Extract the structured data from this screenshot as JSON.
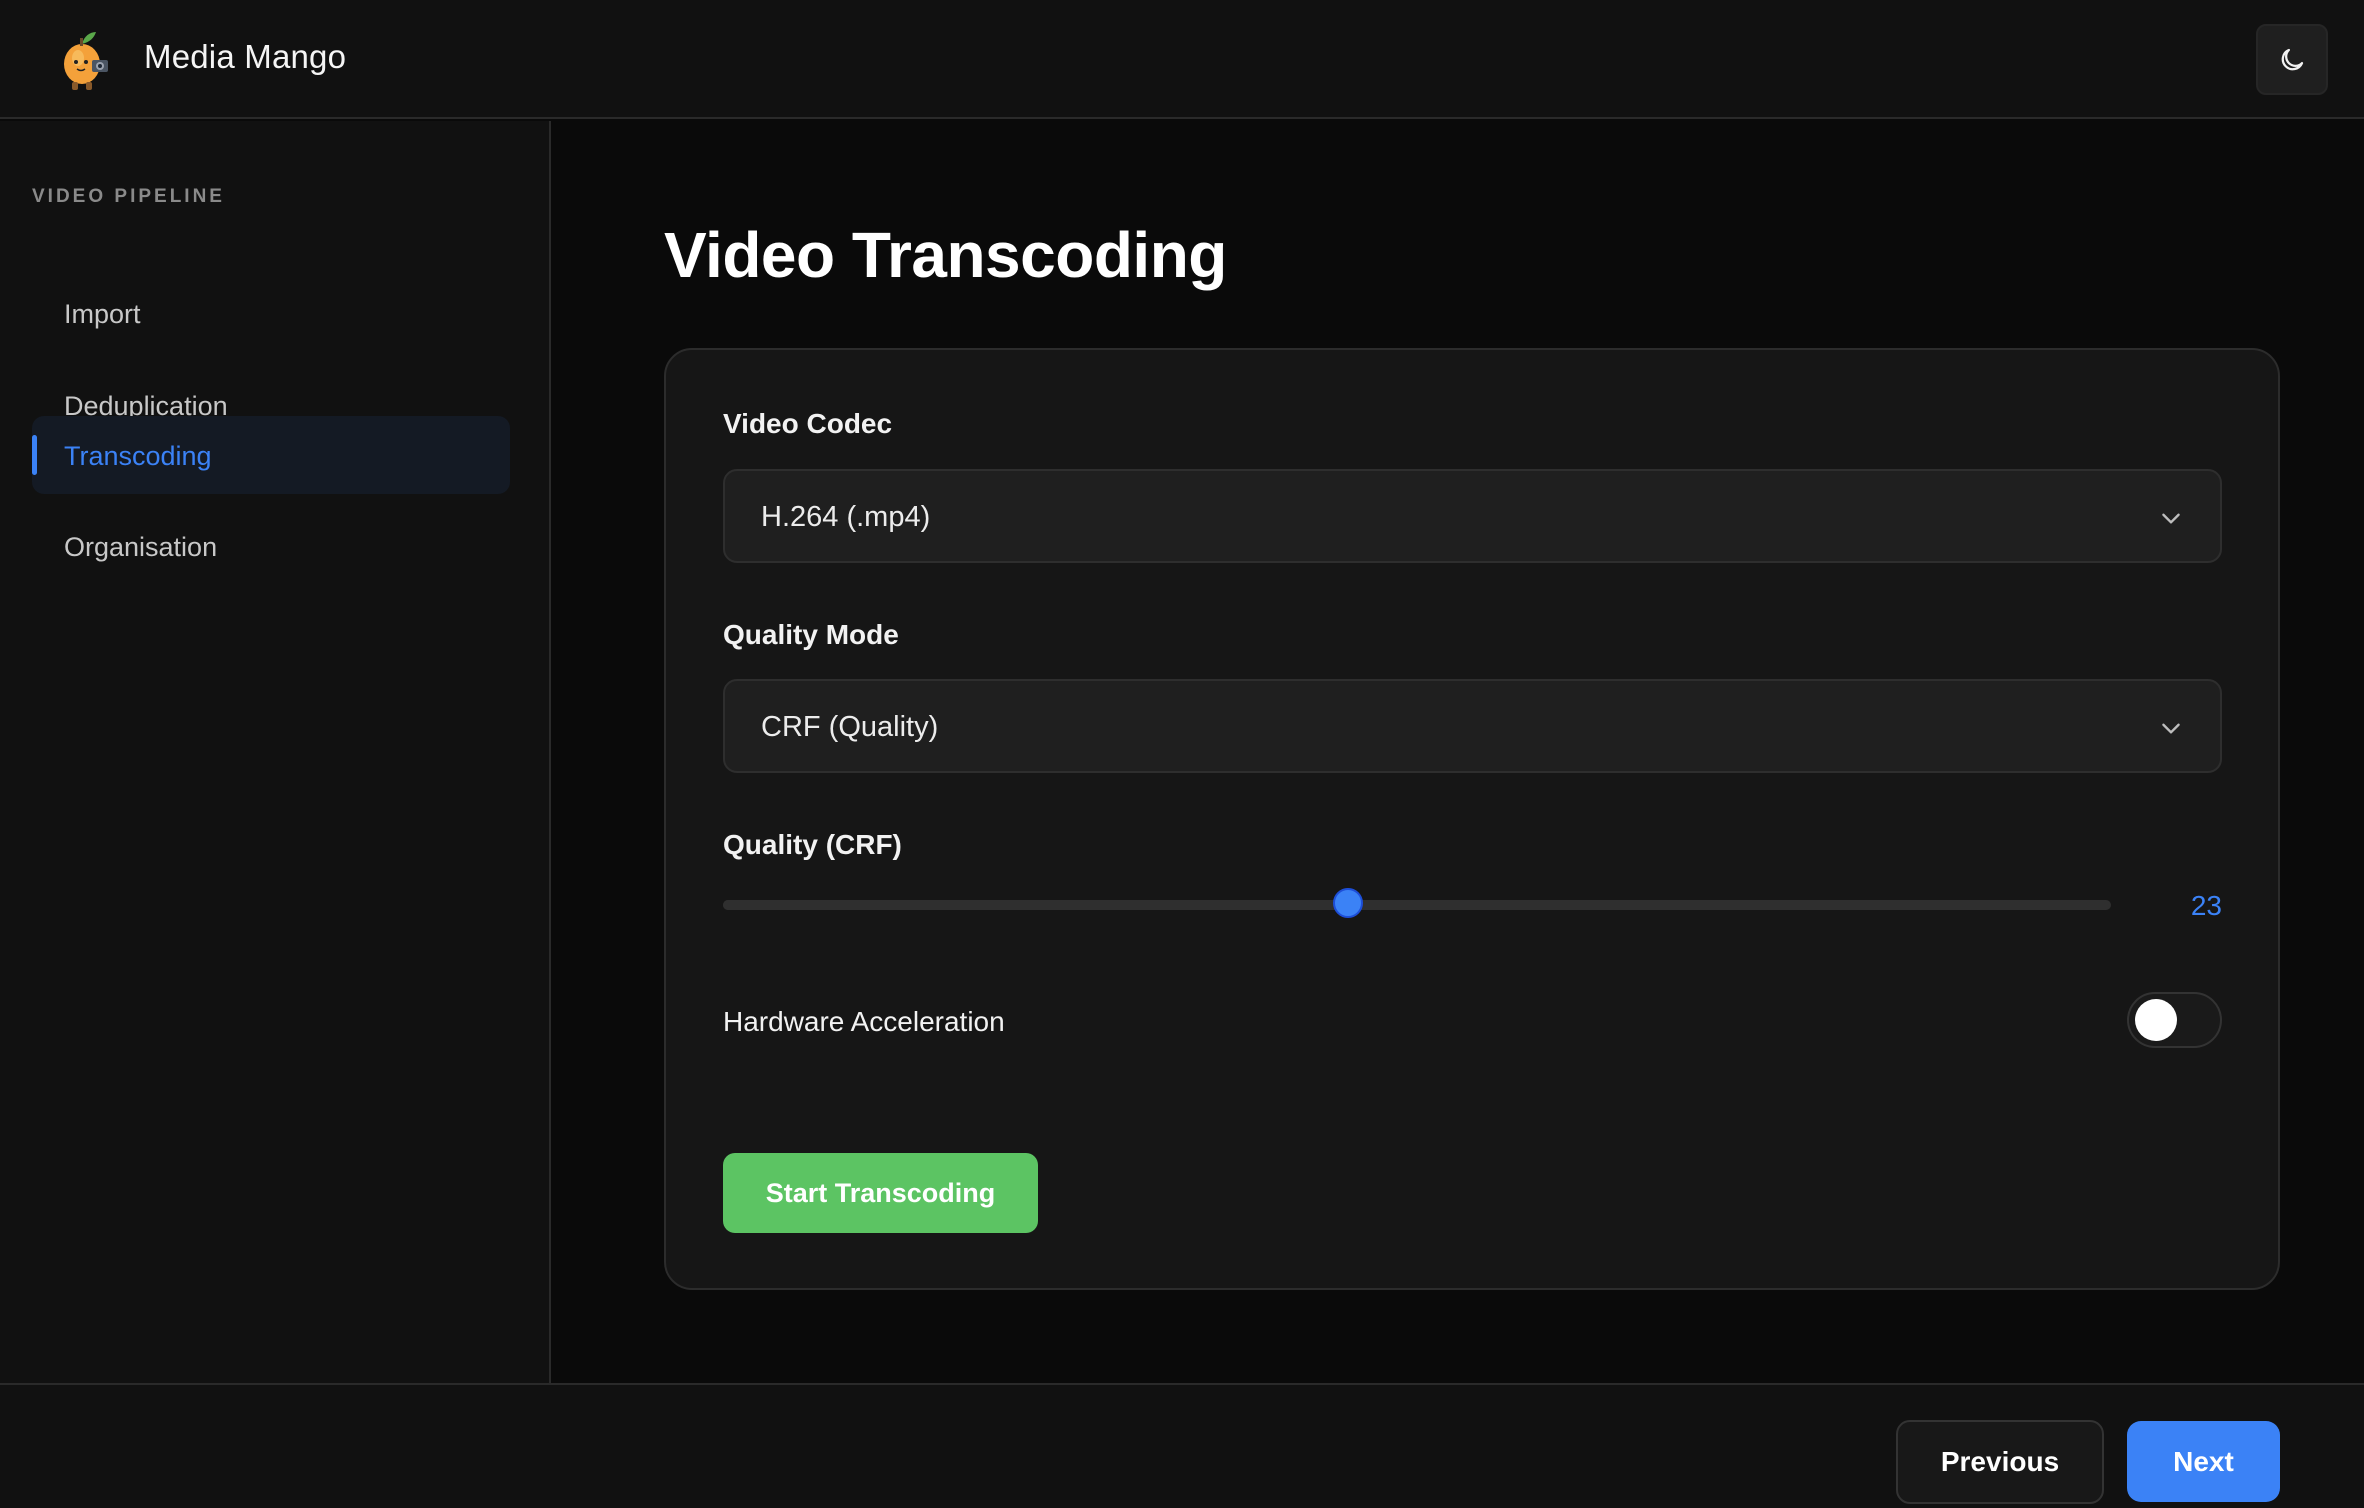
{
  "header": {
    "app_title": "Media Mango",
    "logo_icon": "mango-mascot-logo",
    "theme_toggle_icon": "moon-icon"
  },
  "sidebar": {
    "heading": "VIDEO PIPELINE",
    "items": [
      {
        "label": "Import",
        "active": false
      },
      {
        "label": "Deduplication",
        "active": false
      },
      {
        "label": "Transcoding",
        "active": true
      },
      {
        "label": "Organisation",
        "active": false
      }
    ]
  },
  "main": {
    "title": "Video Transcoding",
    "video_codec": {
      "label": "Video Codec",
      "value": "H.264 (.mp4)"
    },
    "quality_mode": {
      "label": "Quality Mode",
      "value": "CRF (Quality)"
    },
    "quality_crf": {
      "label": "Quality (CRF)",
      "value": "23",
      "fraction": 0.45
    },
    "hardware_acceleration": {
      "label": "Hardware Acceleration",
      "enabled": false
    },
    "start_button": "Start Transcoding"
  },
  "footer": {
    "previous": "Previous",
    "next": "Next"
  },
  "colors": {
    "accent": "#3b82f6",
    "start_button": "#5cc463",
    "background": "#0a0a0a",
    "card": "#161616"
  }
}
